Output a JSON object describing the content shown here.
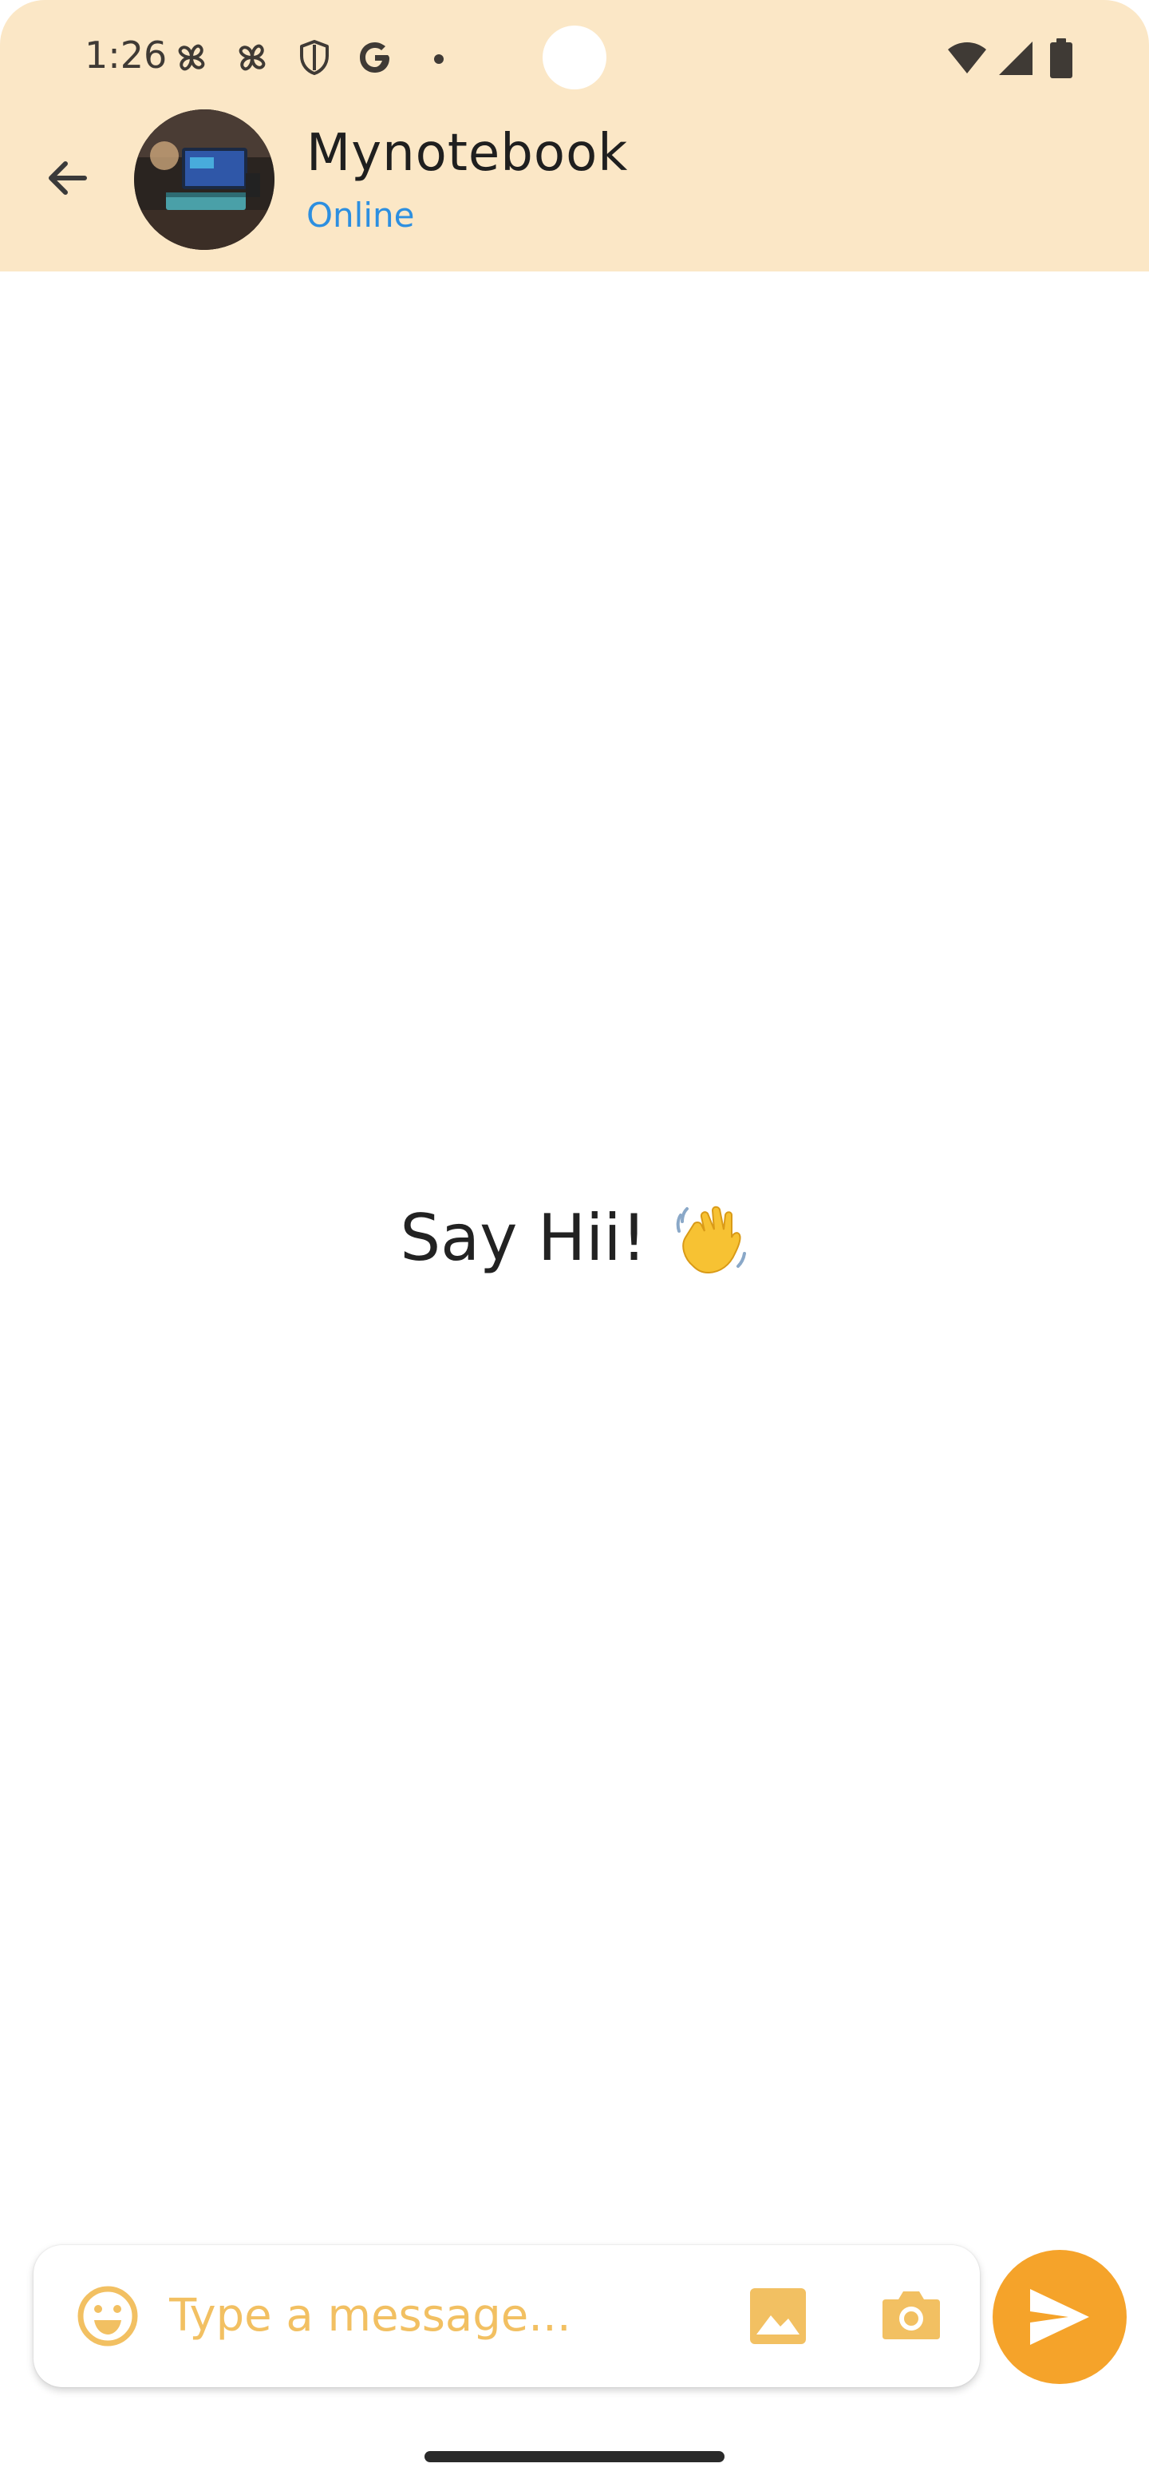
{
  "status_bar": {
    "time": "1:26",
    "left_icons": [
      "pinwheel-icon",
      "pinwheel-icon",
      "shield-icon",
      "google-icon",
      "dot-icon"
    ],
    "right_icons": [
      "wifi-icon",
      "cell-signal-icon",
      "battery-icon"
    ]
  },
  "app_bar": {
    "back_icon": "arrow-back-icon",
    "contact_name": "Mynotebook",
    "contact_status": "Online"
  },
  "chat": {
    "empty_message": "Say Hii!",
    "empty_emoji": "waving-hand-icon"
  },
  "composer": {
    "placeholder": "Type a message...",
    "emoji_icon": "smiley-icon",
    "gallery_icon": "image-icon",
    "camera_icon": "camera-icon",
    "send_icon": "send-icon"
  },
  "colors": {
    "header_bg": "#fbe7c6",
    "accent": "#f5a32a",
    "icon_accent": "#f2c062",
    "online": "#2d8fe0"
  }
}
